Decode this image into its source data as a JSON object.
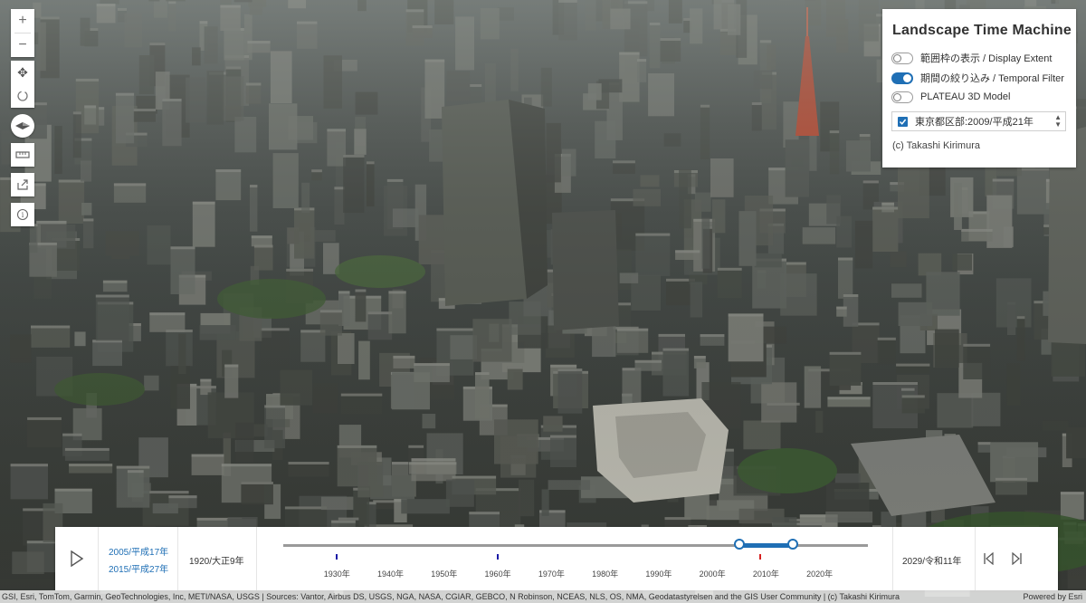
{
  "map": {
    "scene_description_icon": "3d-city-view"
  },
  "nav": {
    "zoom_in": "+",
    "zoom_out": "−",
    "pan_icon": "✥",
    "rotate_icon": "↻",
    "compass_icon": "compass",
    "measure_icon": "ruler",
    "share_icon": "share",
    "info_icon": "i"
  },
  "panel": {
    "title": "Landscape Time Machine",
    "toggles": [
      {
        "label": "範囲枠の表示 / Display Extent",
        "on": false
      },
      {
        "label": "期間の絞り込み / Temporal Filter",
        "on": true
      },
      {
        "label": "PLATEAU 3D Model",
        "on": false
      }
    ],
    "layer_select": "東京都区部:2009/平成21年",
    "credit": "(c) Takashi Kirimura"
  },
  "timeslider": {
    "range_start": "2005/平成17年",
    "range_end": "2015/平成27年",
    "min_label": "1920/大正9年",
    "max_label": "2029/令和11年",
    "tick_labels": [
      "1930年",
      "1940年",
      "1950年",
      "1960年",
      "1970年",
      "1980年",
      "1990年",
      "2000年",
      "2010年",
      "2020年"
    ],
    "min_year": 1920,
    "max_year": 2029,
    "selected_start_year": 2005,
    "selected_end_year": 2015,
    "marker_years": [
      1930,
      1960
    ],
    "current_marker_year": 2009,
    "colors": {
      "accent": "#1f6fb5",
      "marker": "#1a1aa6",
      "current": "#d62020"
    }
  },
  "attribution": {
    "sources": "GSI, Esri, TomTom, Garmin, GeoTechnologies, Inc, METI/NASA, USGS | Sources: Vantor, Airbus DS, USGS, NGA, NASA, CGIAR, GEBCO, N Robinson, NCEAS, NLS, OS, NMA, Geodatastyrelsen and the GIS User Community | (c) Takashi Kirimura",
    "powered_by": "Powered by Esri"
  }
}
